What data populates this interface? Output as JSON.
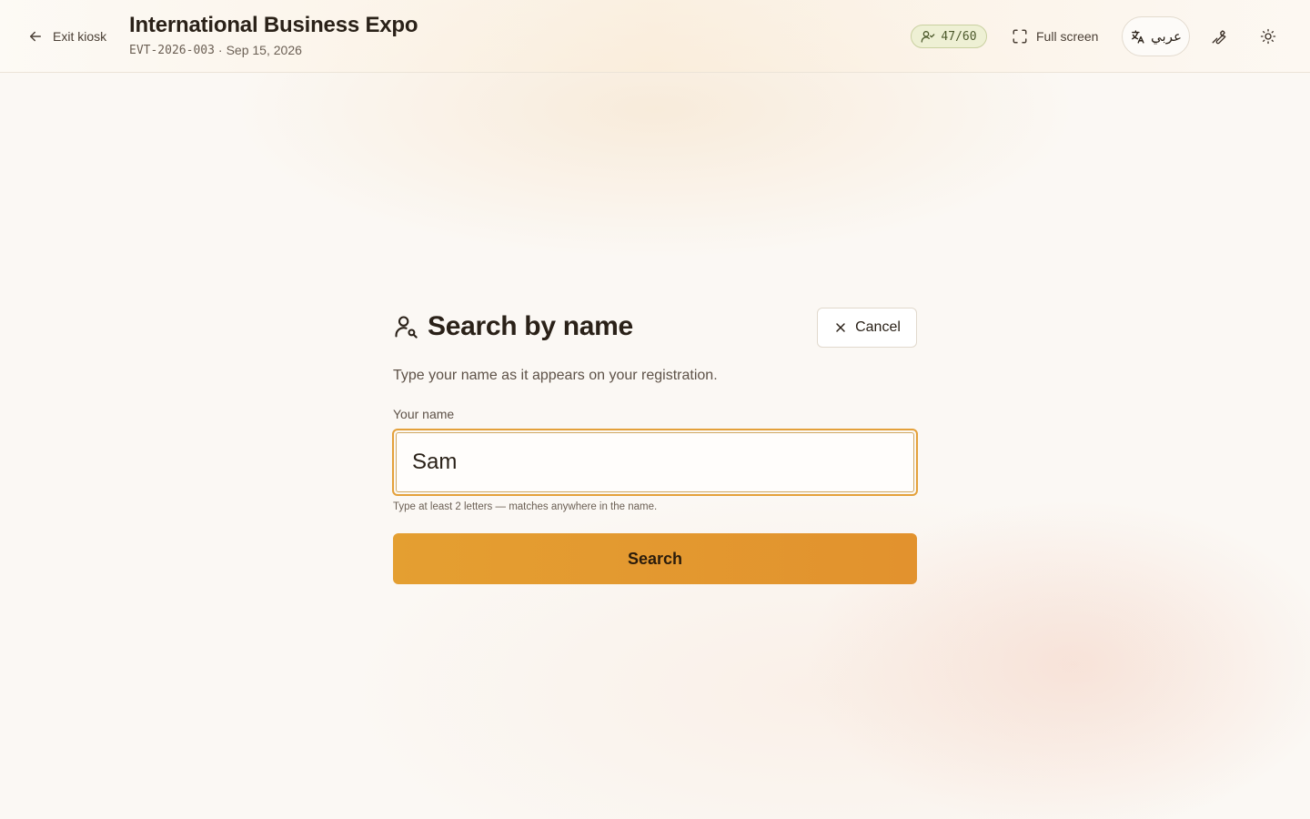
{
  "header": {
    "exit_label": "Exit kiosk",
    "title": "International Business Expo",
    "event_code": "EVT-2026-003",
    "separator": "·",
    "event_date": "Sep 15, 2026",
    "attendance_badge": "47/60",
    "fullscreen_label": "Full screen",
    "language_label": "عربي",
    "icons": [
      "arrow-left-icon",
      "users-icon",
      "fullscreen-icon",
      "translate-icon",
      "wrench-icon",
      "sun-icon"
    ]
  },
  "search_panel": {
    "title": "Search by name",
    "cancel_label": "Cancel",
    "description": "Type your name as it appears on your registration.",
    "field_label": "Your name",
    "field_value": "Sam",
    "hint": "Type at least 2 letters — matches anywhere in the name.",
    "submit_label": "Search"
  },
  "colors": {
    "accent": "#e49f31",
    "badge_bg": "#eef0d4",
    "text": "#2a2118"
  }
}
